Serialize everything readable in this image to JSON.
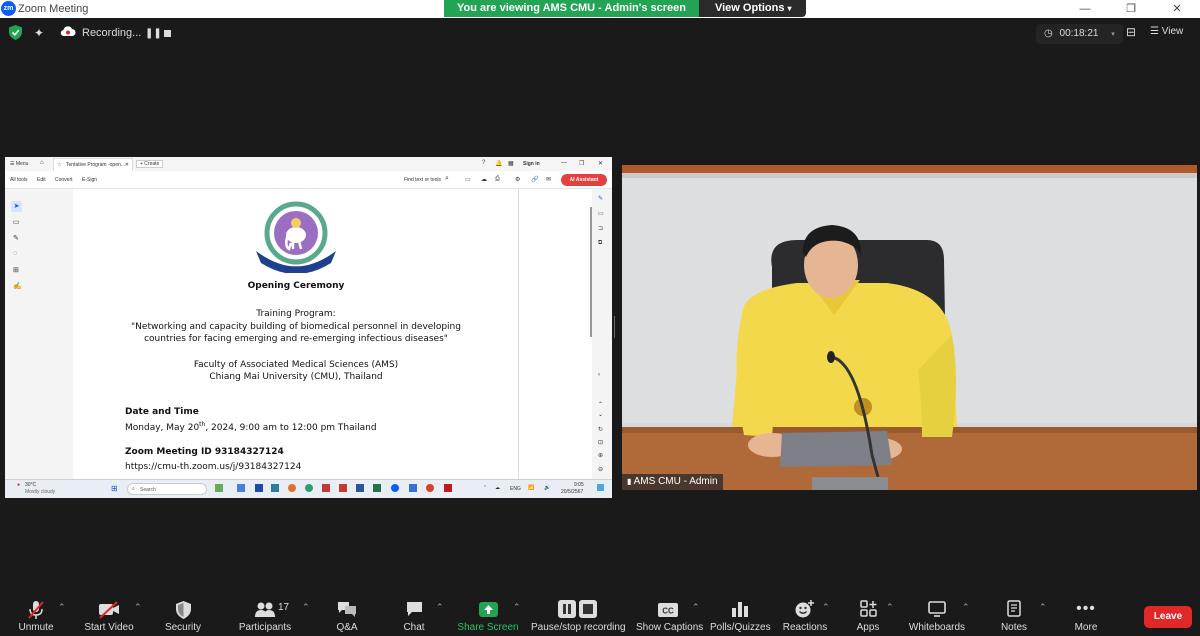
{
  "titlebar": {
    "app_title": "Zoom Meeting",
    "logo": "zm",
    "minimize": "—",
    "maximize": "❐",
    "close": "✕"
  },
  "share_banner": {
    "text": "You are viewing AMS CMU - Admin's screen",
    "view_options": "View Options"
  },
  "topbar": {
    "recording_label": "Recording...",
    "timer": "00:18:21",
    "view_label": "View"
  },
  "shared_screen": {
    "tab_menu": "Menu",
    "tab_title": "Tentative Program -open...",
    "tab_create": "+ Create",
    "sign_in": "Sign in",
    "tools": [
      "All tools",
      "Edit",
      "Convert",
      "E-Sign"
    ],
    "find_text": "Find text or tools",
    "ai_assistant": "AI Assistant",
    "document": {
      "heading": "Opening Ceremony",
      "subheading": "Training Program:",
      "program_line1": "\"Networking and capacity building of biomedical personnel in developing",
      "program_line2": "countries for facing emerging and re-emerging infectious diseases\"",
      "faculty_line1": "Faculty of Associated Medical Sciences (AMS)",
      "faculty_line2": "Chiang Mai University (CMU), Thailand",
      "date_heading": "Date and Time",
      "date_pre": "Monday, May 20",
      "date_sup": "th",
      "date_post": ", 2024, 9:00 am to 12:00 pm Thailand",
      "zoom_heading": "Zoom Meeting ID 93184327124",
      "zoom_link": "https://cmu-th.zoom.us/j/93184327124"
    },
    "taskbar": {
      "weather_temp": "30°C",
      "weather_desc": "Mostly cloudy",
      "search": "Search",
      "lang": "ENG",
      "time": "9:05",
      "date": "20/5/2567"
    }
  },
  "video": {
    "participant_name": "AMS CMU - Admin"
  },
  "toolbar": {
    "unmute": "Unmute",
    "start_video": "Start Video",
    "security": "Security",
    "participants": "Participants",
    "participants_count": "17",
    "qa": "Q&A",
    "chat": "Chat",
    "share_screen": "Share Screen",
    "pause_recording": "Pause/stop recording",
    "show_captions": "Show Captions",
    "polls": "Polls/Quizzes",
    "reactions": "Reactions",
    "apps": "Apps",
    "whiteboards": "Whiteboards",
    "notes": "Notes",
    "more": "More",
    "leave": "Leave"
  },
  "colors": {
    "share_green": "#23a455",
    "leave_red": "#e02828",
    "zoom_blue": "#0b5cff",
    "ai_button": "#e34040"
  }
}
